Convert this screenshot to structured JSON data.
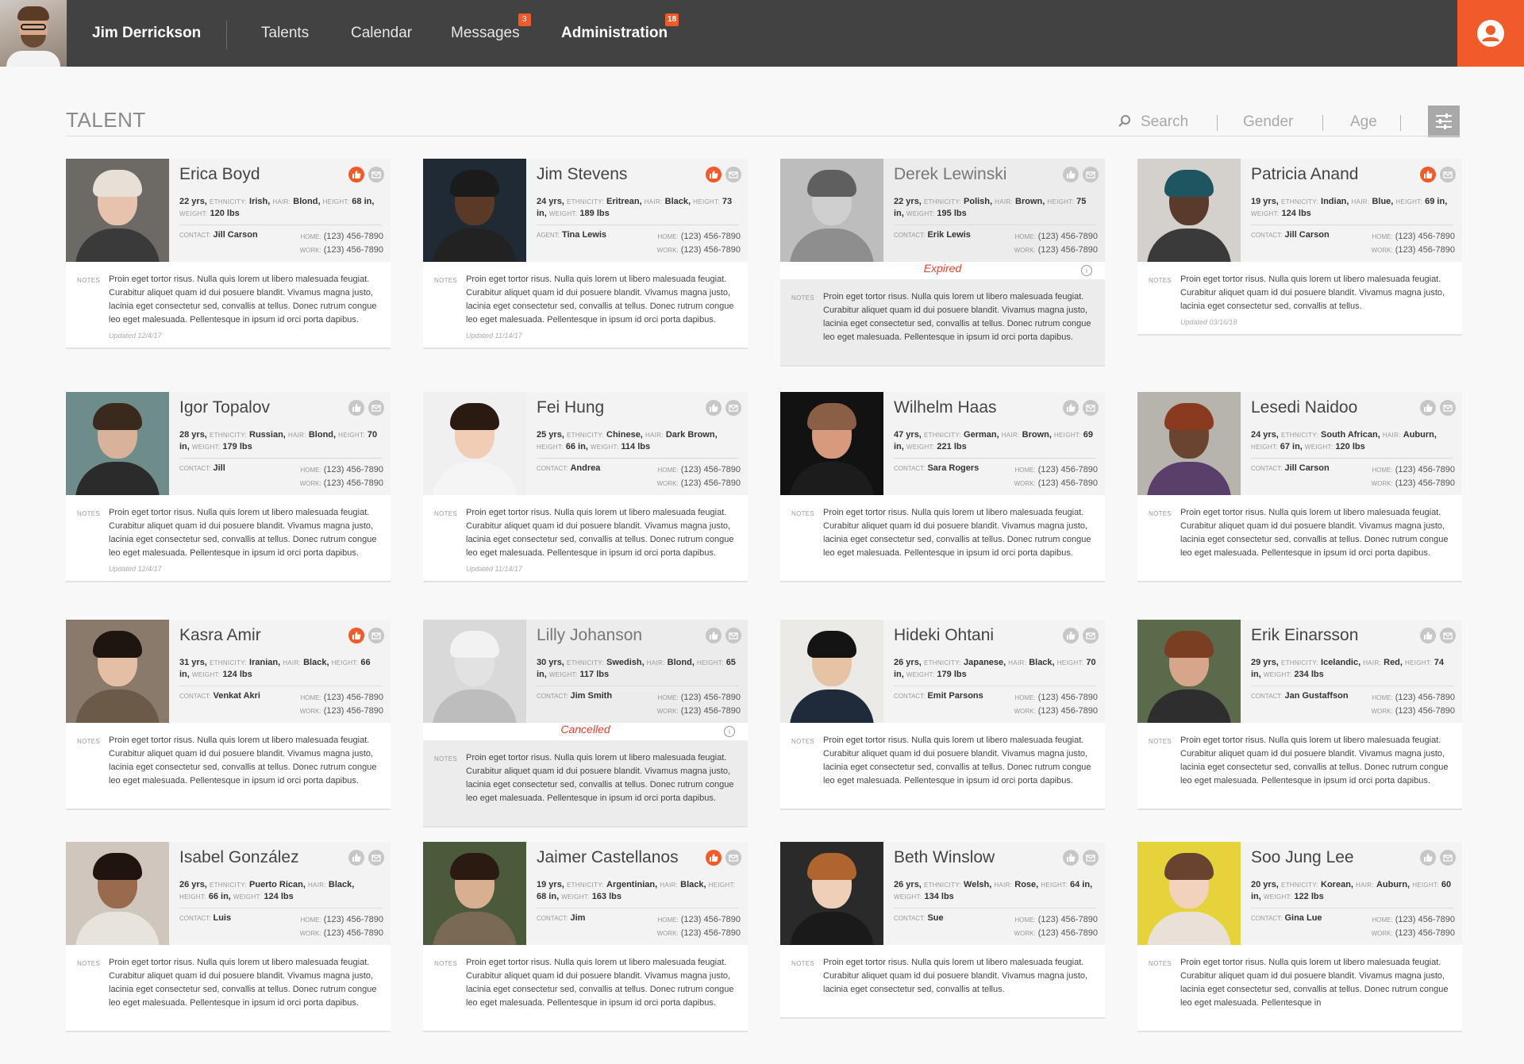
{
  "topbar": {
    "user_name": "Jim Derrickson",
    "nav": [
      {
        "label": "Talents",
        "badge": ""
      },
      {
        "label": "Calendar",
        "badge": ""
      },
      {
        "label": "Messages",
        "badge": "3"
      },
      {
        "label": "Administration",
        "badge": "18"
      }
    ],
    "active": "Administration",
    "accent_color": "#f15a29",
    "profile_icon": "user-circle-icon"
  },
  "toolbar": {
    "title": "TALENT",
    "search_placeholder": "Search",
    "gender_label": "Gender",
    "age_label": "Age",
    "filter_icon": "sliders-icon"
  },
  "labels": {
    "notes": "NOTES",
    "ethnicity": "ETHNICITY:",
    "hair": "HAIR:",
    "height": "HEIGHT:",
    "weight": "WEIGHT:",
    "contact": "CONTACT:",
    "agent": "AGENT:",
    "home": "HOME:",
    "work": "WORK:"
  },
  "notes_text": "Proin eget tortor risus. Nulla quis lorem ut libero malesuada feugiat. Curabitur aliquet quam id dui posuere blandit. Vivamus magna justo, lacinia eget consectetur sed, convallis at tellus. Donec rutrum congue leo eget malesuada. Pellentesque in ipsum id orci porta dapibus.",
  "talents": [
    {
      "name": "Erica Boyd",
      "age": "22 yrs,",
      "ethnicity": "Irish,",
      "hair": "Blond,",
      "height": "68 in,",
      "weight": "120 lbs",
      "contact_label": "CONTACT:",
      "contact": "Jill Carson",
      "home": "(123) 456-7890",
      "work": "(123) 456-7890",
      "liked": true,
      "status": "",
      "updated": "Updated 12/4/17",
      "notes": "Proin eget tortor risus. Nulla quis lorem ut libero malesuada feugiat. Curabitur aliquet quam id dui posuere blandit. Vivamus magna justo, lacinia eget consectetur sed, convallis at tellus. Donec rutrum congue leo eget malesuada. Pellentesque in ipsum id orci porta dapibus."
    },
    {
      "name": "Jim Stevens",
      "age": "24 yrs,",
      "ethnicity": "Eritrean,",
      "hair": "Black,",
      "height": "73 in,",
      "weight": "189 lbs",
      "contact_label": "AGENT:",
      "contact": "Tina Lewis",
      "home": "(123) 456-7890",
      "work": "(123) 456-7890",
      "liked": true,
      "status": "",
      "updated": "Updated 11/14/17",
      "notes": "Proin eget tortor risus. Nulla quis lorem ut libero malesuada feugiat. Curabitur aliquet quam id dui posuere blandit. Vivamus magna justo, lacinia eget consectetur sed, convallis at tellus. Donec rutrum congue leo eget malesuada. Pellentesque in ipsum id orci porta dapibus."
    },
    {
      "name": "Derek Lewinski",
      "age": "22 yrs,",
      "ethnicity": "Polish,",
      "hair": "Brown,",
      "height": "75 in,",
      "weight": "195 lbs",
      "contact_label": "CONTACT:",
      "contact": "Erik Lewis",
      "home": "(123) 456-7890",
      "work": "(123) 456-7890",
      "liked": false,
      "status": "Expired",
      "updated": "",
      "notes": "Proin eget tortor risus. Nulla quis lorem ut libero malesuada feugiat. Curabitur aliquet quam id dui posuere blandit. Vivamus magna justo, lacinia eget consectetur sed, convallis at tellus. Donec rutrum congue leo eget malesuada. Pellentesque in ipsum id orci porta dapibus."
    },
    {
      "name": "Patricia Anand",
      "age": "19 yrs,",
      "ethnicity": "Indian,",
      "hair": "Blue,",
      "height": "69 in,",
      "weight": "124 lbs",
      "contact_label": "CONTACT:",
      "contact": "Jill Carson",
      "home": "(123) 456-7890",
      "work": "(123) 456-7890",
      "liked": true,
      "status": "",
      "updated": "Updated 03/16/18",
      "notes": "Proin eget tortor risus. Nulla quis lorem ut libero malesuada feugiat. Curabitur aliquet quam id dui posuere blandit. Vivamus magna justo, lacinia eget consectetur sed, convallis at tellus."
    },
    {
      "name": "Igor Topalov",
      "age": "28 yrs,",
      "ethnicity": "Russian,",
      "hair": "Blond,",
      "height": "70 in,",
      "weight": "179 lbs",
      "contact_label": "CONTACT:",
      "contact": "Jill",
      "home": "(123) 456-7890",
      "work": "(123) 456-7890",
      "liked": false,
      "status": "",
      "updated": "Updated 12/4/17",
      "notes": "Proin eget tortor risus. Nulla quis lorem ut libero malesuada feugiat. Curabitur aliquet quam id dui posuere blandit. Vivamus magna justo, lacinia eget consectetur sed, convallis at tellus. Donec rutrum congue leo eget malesuada. Pellentesque in ipsum id orci porta dapibus."
    },
    {
      "name": "Fei Hung",
      "age": "25 yrs,",
      "ethnicity": "Chinese,",
      "hair": "Dark Brown,",
      "height": "66 in,",
      "weight": "114 lbs",
      "contact_label": "CONTACT:",
      "contact": "Andrea",
      "home": "(123) 456-7890",
      "work": "(123) 456-7890",
      "liked": false,
      "status": "",
      "updated": "Updated 11/14/17",
      "notes": "Proin eget tortor risus. Nulla quis lorem ut libero malesuada feugiat. Curabitur aliquet quam id dui posuere blandit. Vivamus magna justo, lacinia eget consectetur sed, convallis at tellus. Donec rutrum congue leo eget malesuada. Pellentesque in ipsum id orci porta dapibus."
    },
    {
      "name": "Wilhelm Haas",
      "age": "47 yrs,",
      "ethnicity": "German,",
      "hair": "Brown,",
      "height": "69 in,",
      "weight": "221 lbs",
      "contact_label": "CONTACT:",
      "contact": "Sara Rogers",
      "home": "(123) 456-7890",
      "work": "(123) 456-7890",
      "liked": false,
      "status": "",
      "updated": "",
      "notes": "Proin eget tortor risus. Nulla quis lorem ut libero malesuada feugiat. Curabitur aliquet quam id dui posuere blandit. Vivamus magna justo, lacinia eget consectetur sed, convallis at tellus. Donec rutrum congue leo eget malesuada. Pellentesque in ipsum id orci porta dapibus."
    },
    {
      "name": "Lesedi Naidoo",
      "age": "24 yrs,",
      "ethnicity": "South African,",
      "hair": "Auburn,",
      "height": "67 in,",
      "weight": "120 lbs",
      "contact_label": "CONTACT:",
      "contact": "Jill Carson",
      "home": "(123) 456-7890",
      "work": "(123) 456-7890",
      "liked": false,
      "status": "",
      "updated": "",
      "notes": "Proin eget tortor risus. Nulla quis lorem ut libero malesuada feugiat. Curabitur aliquet quam id dui posuere blandit. Vivamus magna justo, lacinia eget consectetur sed, convallis at tellus. Donec rutrum congue leo eget malesuada. Pellentesque in ipsum id orci porta dapibus."
    },
    {
      "name": "Kasra Amir",
      "age": "31 yrs,",
      "ethnicity": "Iranian,",
      "hair": "Black,",
      "height": "66 in,",
      "weight": "124 lbs",
      "contact_label": "CONTACT:",
      "contact": "Venkat Akri",
      "home": "(123) 456-7890",
      "work": "(123) 456-7890",
      "liked": true,
      "status": "",
      "updated": "",
      "notes": "Proin eget tortor risus. Nulla quis lorem ut libero malesuada feugiat. Curabitur aliquet quam id dui posuere blandit. Vivamus magna justo, lacinia eget consectetur sed, convallis at tellus. Donec rutrum congue leo eget malesuada. Pellentesque in ipsum id orci porta dapibus."
    },
    {
      "name": "Lilly Johanson",
      "age": "30 yrs,",
      "ethnicity": "Swedish,",
      "hair": "Blond,",
      "height": "65 in,",
      "weight": "117 lbs",
      "contact_label": "CONTACT:",
      "contact": "Jim Smith",
      "home": "(123) 456-7890",
      "work": "(123) 456-7890",
      "liked": false,
      "status": "Cancelled",
      "updated": "",
      "notes": "Proin eget tortor risus. Nulla quis lorem ut libero malesuada feugiat. Curabitur aliquet quam id dui posuere blandit. Vivamus magna justo, lacinia eget consectetur sed, convallis at tellus. Donec rutrum congue leo eget malesuada. Pellentesque in ipsum id orci porta dapibus."
    },
    {
      "name": "Hideki Ohtani",
      "age": "26 yrs,",
      "ethnicity": "Japanese,",
      "hair": "Black,",
      "height": "70 in,",
      "weight": "179 lbs",
      "contact_label": "CONTACT:",
      "contact": "Emit Parsons",
      "home": "(123) 456-7890",
      "work": "(123) 456-7890",
      "liked": false,
      "status": "",
      "updated": "",
      "notes": "Proin eget tortor risus. Nulla quis lorem ut libero malesuada feugiat. Curabitur aliquet quam id dui posuere blandit. Vivamus magna justo, lacinia eget consectetur sed, convallis at tellus. Donec rutrum congue leo eget malesuada. Pellentesque in ipsum id orci porta dapibus."
    },
    {
      "name": "Erik Einarsson",
      "age": "29 yrs,",
      "ethnicity": "Icelandic,",
      "hair": "Red,",
      "height": "74 in,",
      "weight": "234 lbs",
      "contact_label": "CONTACT:",
      "contact": "Jan Gustaffson",
      "home": "(123) 456-7890",
      "work": "(123) 456-7890",
      "liked": false,
      "status": "",
      "updated": "",
      "notes": "Proin eget tortor risus. Nulla quis lorem ut libero malesuada feugiat. Curabitur aliquet quam id dui posuere blandit. Vivamus magna justo, lacinia eget consectetur sed, convallis at tellus. Donec rutrum congue leo eget malesuada. Pellentesque in ipsum id orci porta dapibus."
    },
    {
      "name": "Isabel González",
      "age": "26 yrs,",
      "ethnicity": "Puerto Rican,",
      "hair": "Black,",
      "height": "66 in,",
      "weight": "124 lbs",
      "contact_label": "CONTACT:",
      "contact": "Luis",
      "home": "(123) 456-7890",
      "work": "(123) 456-7890",
      "liked": false,
      "status": "",
      "updated": "",
      "notes": "Proin eget tortor risus. Nulla quis lorem ut libero malesuada feugiat. Curabitur aliquet quam id dui posuere blandit. Vivamus magna justo, lacinia eget consectetur sed, convallis at tellus. Donec rutrum congue leo eget malesuada. Pellentesque in ipsum id orci porta dapibus."
    },
    {
      "name": "Jaimer Castellanos",
      "age": "19 yrs,",
      "ethnicity": "Argentinian,",
      "hair": "Black,",
      "height": "68 in,",
      "weight": "163 lbs",
      "contact_label": "CONTACT:",
      "contact": "Jim",
      "home": "(123) 456-7890",
      "work": "(123) 456-7890",
      "liked": true,
      "status": "",
      "updated": "",
      "notes": "Proin eget tortor risus. Nulla quis lorem ut libero malesuada feugiat. Curabitur aliquet quam id dui posuere blandit. Vivamus magna justo, lacinia eget consectetur sed, convallis at tellus. Donec rutrum congue leo eget malesuada. Pellentesque in ipsum id orci porta dapibus."
    },
    {
      "name": "Beth Winslow",
      "age": "26 yrs,",
      "ethnicity": "Welsh,",
      "hair": "Rose,",
      "height": "64 in,",
      "weight": "134 lbs",
      "contact_label": "CONTACT:",
      "contact": "Sue",
      "home": "(123) 456-7890",
      "work": "(123) 456-7890",
      "liked": false,
      "status": "",
      "updated": "",
      "notes": "Proin eget tortor risus. Nulla quis lorem ut libero malesuada feugiat. Curabitur aliquet quam id dui posuere blandit. Vivamus magna justo, lacinia eget consectetur sed, convallis at tellus."
    },
    {
      "name": "Soo Jung Lee",
      "age": "20 yrs,",
      "ethnicity": "Korean,",
      "hair": "Auburn,",
      "height": "60 in,",
      "weight": "122 lbs",
      "contact_label": "CONTACT:",
      "contact": "Gina Lue",
      "home": "(123) 456-7890",
      "work": "(123) 456-7890",
      "liked": false,
      "status": "",
      "updated": "",
      "notes": "Proin eget tortor risus. Nulla quis lorem ut libero malesuada feugiat. Curabitur aliquet quam id dui posuere blandit. Vivamus magna justo, lacinia eget consectetur sed, convallis at tellus. Donec rutrum congue leo eget malesuada. Pellentesque in"
    }
  ]
}
